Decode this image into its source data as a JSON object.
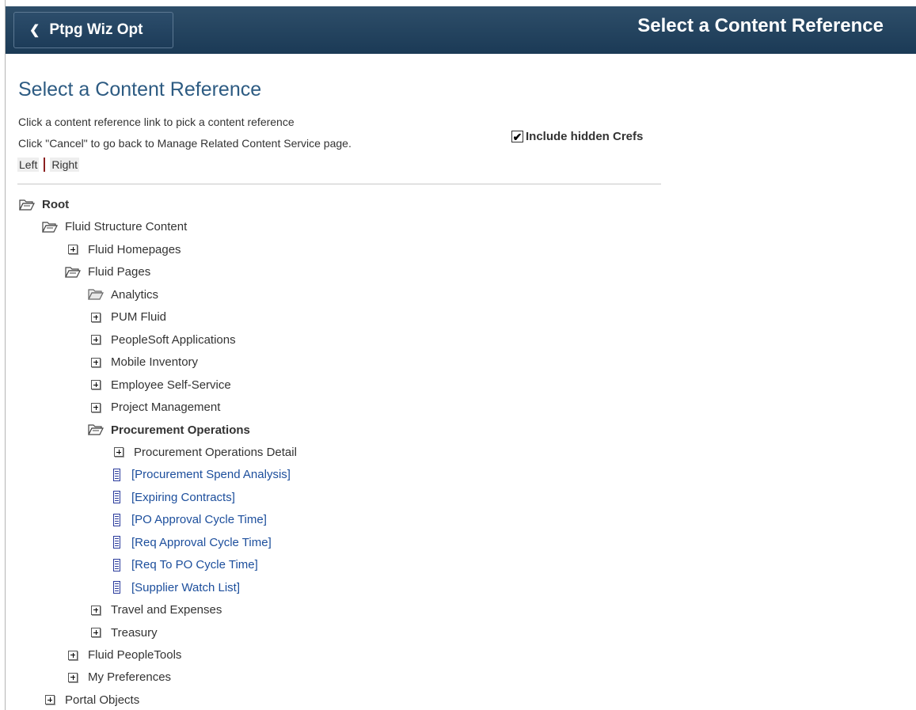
{
  "header": {
    "back_label": "Ptpg Wiz Opt",
    "title": "Select a Content Reference"
  },
  "page": {
    "title": "Select a Content Reference",
    "instruction_1": "Click a content reference link to pick a content reference",
    "instruction_2": "Click \"Cancel\" to go back to Manage Related Content Service page.",
    "include_hidden_label": "Include hidden Crefs",
    "include_hidden_checked": true,
    "left_label": "Left",
    "right_label": "Right"
  },
  "tree": [
    {
      "label": "Root",
      "type": "folder-open",
      "level": 0,
      "style": "root"
    },
    {
      "label": "Fluid Structure Content",
      "type": "folder-open",
      "level": 1
    },
    {
      "label": "Fluid Homepages",
      "type": "plus",
      "level": 2
    },
    {
      "label": "Fluid Pages",
      "type": "folder-open",
      "level": 2
    },
    {
      "label": "Analytics",
      "type": "folder-empty",
      "level": 3
    },
    {
      "label": "PUM Fluid",
      "type": "plus",
      "level": 3
    },
    {
      "label": "PeopleSoft Applications",
      "type": "plus",
      "level": 3
    },
    {
      "label": "Mobile Inventory",
      "type": "plus",
      "level": 3
    },
    {
      "label": "Employee Self-Service",
      "type": "plus",
      "level": 3
    },
    {
      "label": "Project Management",
      "type": "plus",
      "level": 3
    },
    {
      "label": "Procurement Operations",
      "type": "folder-open",
      "level": 3,
      "style": "bold"
    },
    {
      "label": "Procurement Operations Detail",
      "type": "plus",
      "level": 4
    },
    {
      "label": "[Procurement Spend Analysis]",
      "type": "doc",
      "level": 4,
      "style": "link"
    },
    {
      "label": "[Expiring Contracts]",
      "type": "doc",
      "level": 4,
      "style": "link"
    },
    {
      "label": "[PO Approval Cycle Time]",
      "type": "doc",
      "level": 4,
      "style": "link"
    },
    {
      "label": "[Req Approval Cycle Time]",
      "type": "doc",
      "level": 4,
      "style": "link"
    },
    {
      "label": "[Req To PO Cycle Time]",
      "type": "doc",
      "level": 4,
      "style": "link"
    },
    {
      "label": "[Supplier Watch List]",
      "type": "doc",
      "level": 4,
      "style": "link"
    },
    {
      "label": "Travel and Expenses",
      "type": "plus",
      "level": 3
    },
    {
      "label": "Treasury",
      "type": "plus",
      "level": 3
    },
    {
      "label": "Fluid PeopleTools",
      "type": "plus",
      "level": 2
    },
    {
      "label": "My Preferences",
      "type": "plus",
      "level": 2
    },
    {
      "label": "Portal Objects",
      "type": "plus",
      "level": 1
    }
  ]
}
